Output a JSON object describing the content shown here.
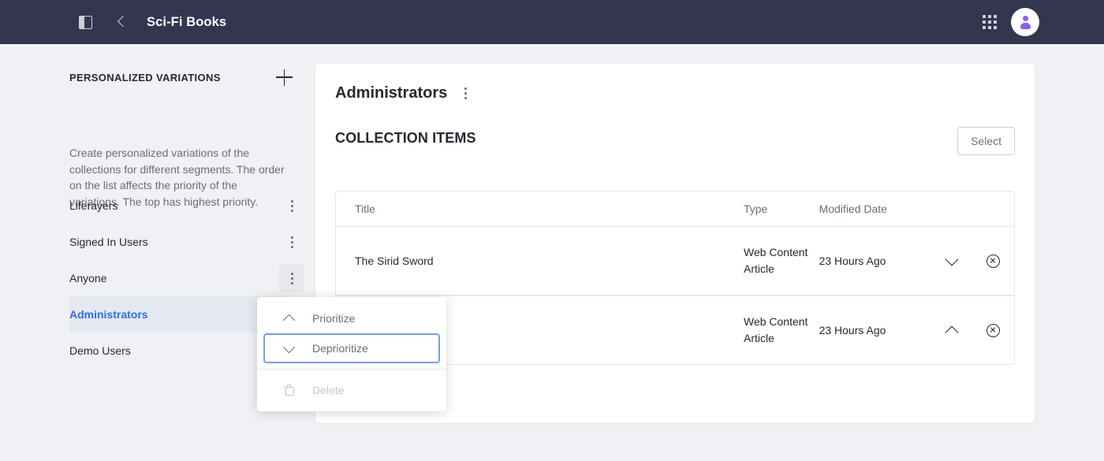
{
  "topbar": {
    "panel_toggle_label": "Toggle Sidebar",
    "back_label": "Back",
    "title": "Sci-Fi Books",
    "apps_label": "Applications",
    "avatar_label": "User"
  },
  "sidebar": {
    "title": "PERSONALIZED VARIATIONS",
    "add_label": "+",
    "description": "Create personalized variations of the collections for different segments. The order on the list affects the priority of the variations. The top has highest priority.",
    "items": [
      {
        "label": "Liferayers",
        "selected": false
      },
      {
        "label": "Signed In Users",
        "selected": false
      },
      {
        "label": "Anyone",
        "selected": false
      },
      {
        "label": "Administrators",
        "selected": true
      },
      {
        "label": "Demo Users",
        "selected": false
      }
    ]
  },
  "dropdown": {
    "items": [
      {
        "label": "Prioritize",
        "icon": "chevron-up-icon",
        "state": "normal"
      },
      {
        "label": "Deprioritize",
        "icon": "chevron-down-icon",
        "state": "focused"
      },
      {
        "label": "Delete",
        "icon": "trash-icon",
        "state": "disabled"
      }
    ]
  },
  "main": {
    "card_title": "Administrators",
    "section_title": "COLLECTION ITEMS",
    "select_label": "Select",
    "table": {
      "columns": [
        "Title",
        "Type",
        "Modified Date"
      ],
      "rows": [
        {
          "title": "The Sirid Sword",
          "type": "Web Content Article",
          "modified": "23 Hours Ago",
          "move_icon": "chevron-down-icon",
          "remove_icon": "times-circle-icon"
        },
        {
          "title": "",
          "type": "Web Content Article",
          "modified": "23 Hours Ago",
          "move_icon": "chevron-up-icon",
          "remove_icon": "times-circle-icon"
        }
      ]
    }
  },
  "colors": {
    "topbar_bg": "#343650",
    "page_bg": "#f0f1f5",
    "accent": "#2f6ded",
    "selected_bg": "#e4e8f1",
    "focus_border": "#6fa1f5",
    "avatar_glyph": "#8b5cf6"
  }
}
